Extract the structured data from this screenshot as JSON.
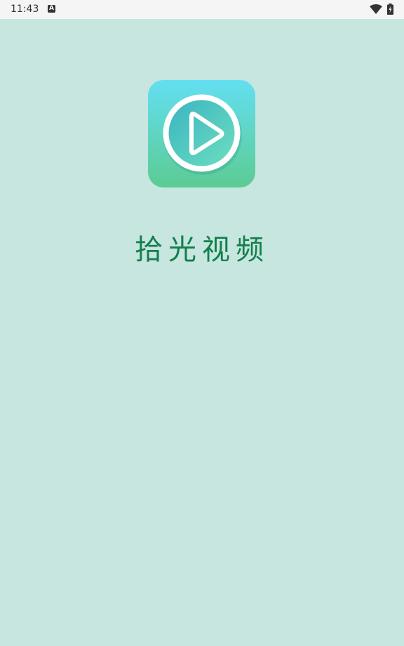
{
  "status_bar": {
    "time": "11:43",
    "notification_icon": "a-letter-icon",
    "notification_letter": "A",
    "wifi_icon": "wifi-icon",
    "battery_icon": "battery-charging-icon"
  },
  "splash": {
    "app_icon": "play-icon",
    "app_name": "拾光视频"
  },
  "colors": {
    "background": "#c6e6df",
    "status_bar_bg": "#f5f5f5",
    "app_name_color": "#137f4c",
    "icon_gradient_top": "#63dff1",
    "icon_gradient_bottom": "#5ccb93"
  }
}
